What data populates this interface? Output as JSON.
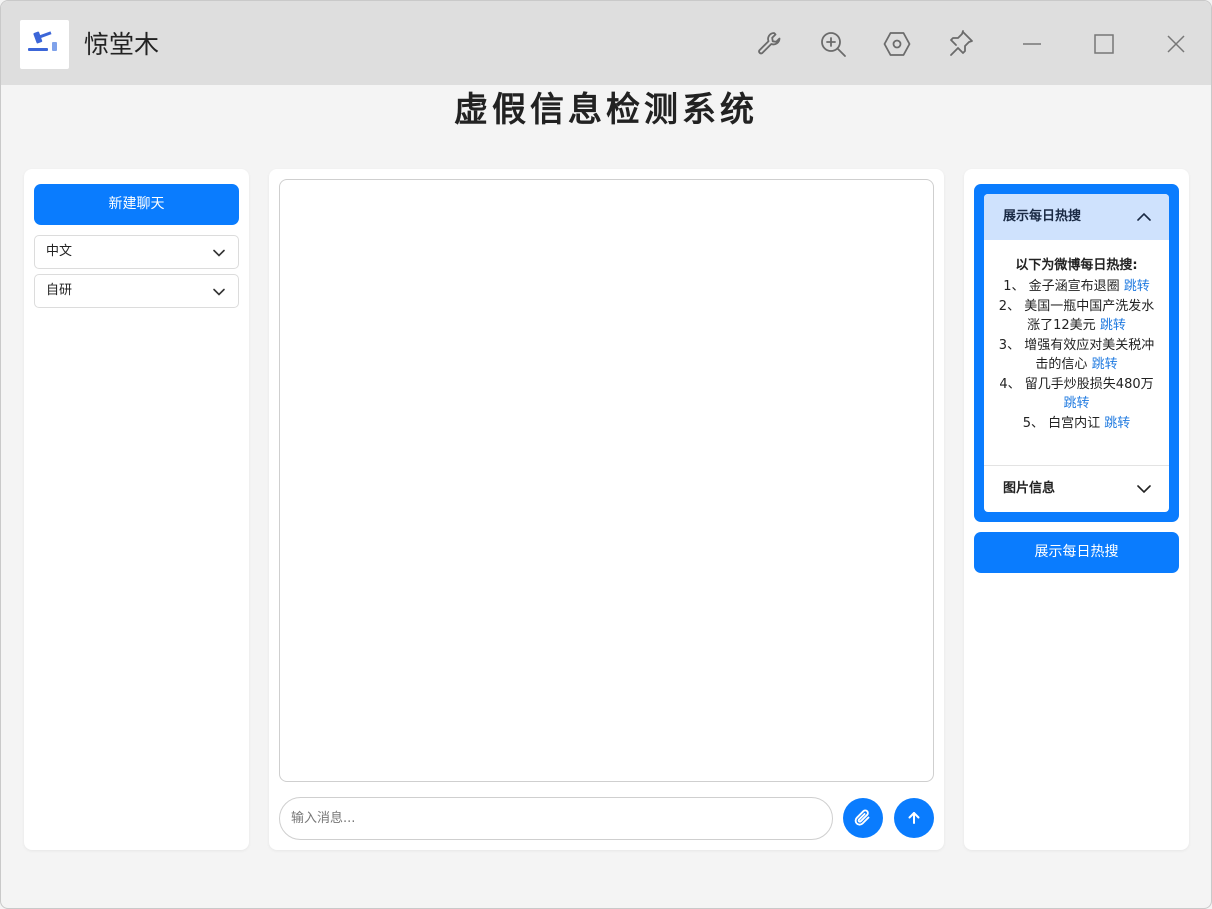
{
  "window": {
    "app_title": "惊堂木",
    "toolbar_icons": [
      "wrench-icon",
      "zoom-in-icon",
      "settings-hex-icon",
      "pin-icon"
    ],
    "controls": [
      "minimize-icon",
      "maximize-icon",
      "close-icon"
    ]
  },
  "page_title": "虚假信息检测系统",
  "left_panel": {
    "new_chat_label": "新建聊天",
    "language_select": "中文",
    "model_select": "自研"
  },
  "chat": {
    "input_placeholder": "输入消息..."
  },
  "right_panel": {
    "accordion_title": "展示每日热搜",
    "intro": "以下为微博每日热搜:",
    "link_label": "跳转",
    "items": [
      {
        "label": "1、 金子涵宣布退圈"
      },
      {
        "label": "2、 美国一瓶中国产洗发水涨了12美元"
      },
      {
        "label": "3、 增强有效应对美关税冲击的信心"
      },
      {
        "label": "4、 留几手炒股损失480万"
      },
      {
        "label": "5、 白宫内讧"
      }
    ],
    "image_info_title": "图片信息",
    "show_hot_button": "展示每日热搜"
  },
  "colors": {
    "accent": "#0a7cfe",
    "accordion_header_bg": "#cfe2fd",
    "link": "#1f7ae0",
    "titlebar_bg": "#dedede"
  }
}
